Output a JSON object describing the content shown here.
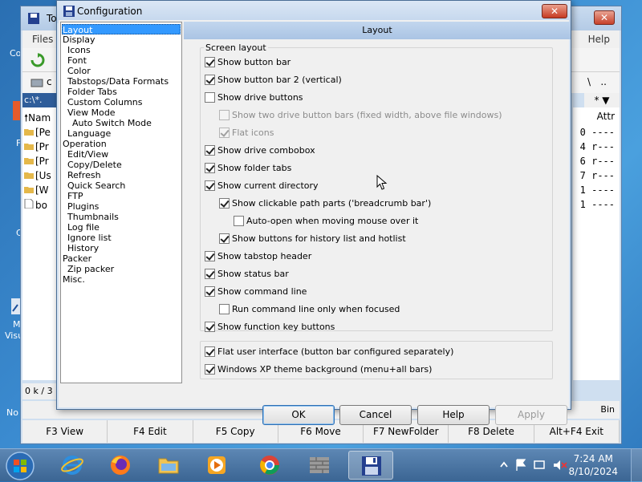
{
  "background_window": {
    "title_fragment": "To",
    "close_label": "✕",
    "menu": {
      "files": "Files",
      "help": "Help"
    },
    "drive_label": "c",
    "path_fragment": "c:\\*.",
    "right_drive_backslash": "\\",
    "right_drive_dots": "..",
    "right_path_star": "* ▼",
    "col_name": "Nam",
    "col_attr": "Attr",
    "left_rows": [
      "[Pe",
      "[Pr",
      "[Pr",
      "[Us",
      "[W",
      "bo"
    ],
    "right_rows": [
      "0  ----",
      "4  r---",
      "6  r---",
      "7  r---",
      "1  ----",
      "1  ----"
    ],
    "status_left": "0 k / 3",
    "cmd_right": "Bin",
    "fkeys": [
      "F3 View",
      "F4 Edit",
      "F5 Copy",
      "F6 Move",
      "F7 NewFolder",
      "F8 Delete",
      "Alt+F4 Exit"
    ]
  },
  "desktop": {
    "fragments": [
      {
        "text": "Co"
      },
      {
        "text": "F"
      },
      {
        "text": "C"
      },
      {
        "text": "M"
      },
      {
        "text": "Visu"
      },
      {
        "text": "No"
      }
    ]
  },
  "dialog": {
    "title": "Configuration",
    "close_label": "✕",
    "panel_title": "Layout",
    "tree": [
      {
        "label": "Layout",
        "indent": 0,
        "selected": true
      },
      {
        "label": "Display",
        "indent": 0
      },
      {
        "label": "Icons",
        "indent": 1
      },
      {
        "label": "Font",
        "indent": 1
      },
      {
        "label": "Color",
        "indent": 1
      },
      {
        "label": "Tabstops/Data Formats",
        "indent": 1
      },
      {
        "label": "Folder Tabs",
        "indent": 1
      },
      {
        "label": "Custom Columns",
        "indent": 1
      },
      {
        "label": "View Mode",
        "indent": 1
      },
      {
        "label": "Auto Switch Mode",
        "indent": 2
      },
      {
        "label": "Language",
        "indent": 1
      },
      {
        "label": "Operation",
        "indent": 0
      },
      {
        "label": "Edit/View",
        "indent": 1
      },
      {
        "label": "Copy/Delete",
        "indent": 1
      },
      {
        "label": "Refresh",
        "indent": 1
      },
      {
        "label": "Quick Search",
        "indent": 1
      },
      {
        "label": "FTP",
        "indent": 1
      },
      {
        "label": "Plugins",
        "indent": 1
      },
      {
        "label": "Thumbnails",
        "indent": 1
      },
      {
        "label": "Log file",
        "indent": 1
      },
      {
        "label": "Ignore list",
        "indent": 1
      },
      {
        "label": "History",
        "indent": 1
      },
      {
        "label": "Packer",
        "indent": 0
      },
      {
        "label": "Zip packer",
        "indent": 1
      },
      {
        "label": "Misc.",
        "indent": 0
      }
    ],
    "screen_layout_legend": "Screen layout",
    "options": [
      {
        "label": "Show button bar",
        "checked": true,
        "disabled": false,
        "level": 0
      },
      {
        "label": "Show button bar 2 (vertical)",
        "checked": true,
        "disabled": false,
        "level": 0
      },
      {
        "label": "Show drive buttons",
        "checked": false,
        "disabled": false,
        "level": 0
      },
      {
        "label": "Show two drive button bars (fixed width, above file windows)",
        "checked": false,
        "disabled": true,
        "level": 1
      },
      {
        "label": "Flat icons",
        "checked": true,
        "disabled": true,
        "level": 1
      },
      {
        "label": "Show drive combobox",
        "checked": true,
        "disabled": false,
        "level": 0
      },
      {
        "label": "Show folder tabs",
        "checked": true,
        "disabled": false,
        "level": 0
      },
      {
        "label": "Show current directory",
        "checked": true,
        "disabled": false,
        "level": 0
      },
      {
        "label": "Show clickable path parts ('breadcrumb bar')",
        "checked": true,
        "disabled": false,
        "level": 1
      },
      {
        "label": "Auto-open when moving mouse over it",
        "checked": false,
        "disabled": false,
        "level": 2
      },
      {
        "label": "Show buttons for history list and hotlist",
        "checked": true,
        "disabled": false,
        "level": 1
      },
      {
        "label": "Show tabstop header",
        "checked": true,
        "disabled": false,
        "level": 0
      },
      {
        "label": "Show status bar",
        "checked": true,
        "disabled": false,
        "level": 0
      },
      {
        "label": "Show command line",
        "checked": true,
        "disabled": false,
        "level": 0
      },
      {
        "label": "Run command line only when focused",
        "checked": false,
        "disabled": false,
        "level": 1
      },
      {
        "label": "Show function key buttons",
        "checked": true,
        "disabled": false,
        "level": 0
      }
    ],
    "extra_options": [
      {
        "label": "Flat user interface (button bar configured separately)",
        "checked": true
      },
      {
        "label": "Windows XP theme background (menu+all bars)",
        "checked": true
      }
    ],
    "buttons": {
      "ok": "OK",
      "cancel": "Cancel",
      "help": "Help",
      "apply": "Apply"
    }
  },
  "taskbar": {
    "time": "7:24 AM",
    "date": "8/10/2024"
  }
}
